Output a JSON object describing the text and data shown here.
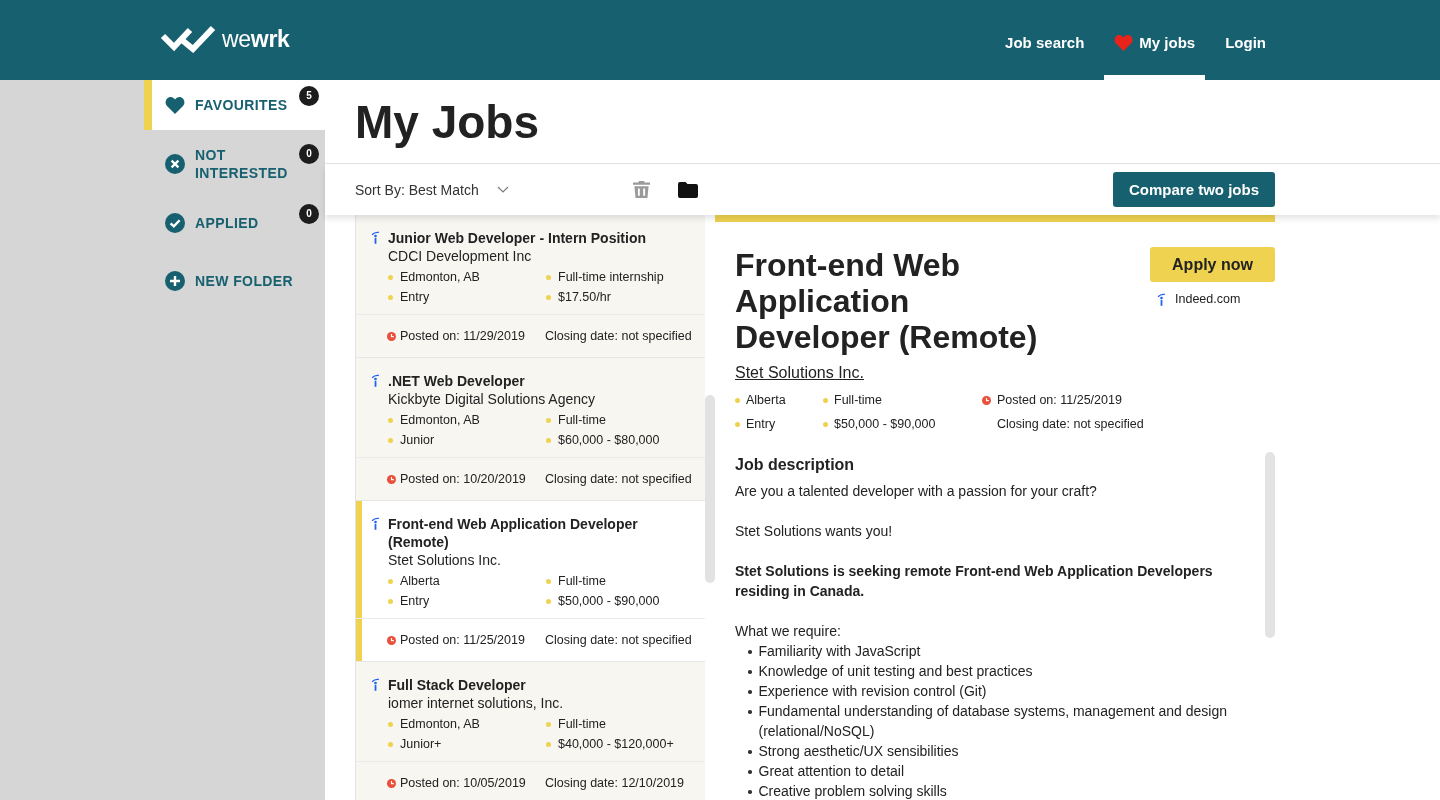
{
  "header": {
    "logo": "we**wrk**",
    "nav": [
      {
        "label": "Job search",
        "kind": "plain",
        "selected": false
      },
      {
        "label": "My jobs",
        "kind": "favourites",
        "selected": true
      },
      {
        "label": "Login",
        "kind": "plain",
        "selected": false
      }
    ]
  },
  "sidebar": {
    "items": [
      {
        "kind": "favourites",
        "label": "FAVOURITES",
        "count": "5",
        "selected": true
      },
      {
        "kind": "not-interested",
        "label": "NOT INTERESTED",
        "count": "0",
        "selected": false
      },
      {
        "kind": "applied",
        "label": "APPLIED",
        "count": "0",
        "selected": false
      },
      {
        "kind": "new-folder",
        "label": "NEW FOLDER",
        "selected": false
      }
    ]
  },
  "page_title": "My Jobs",
  "toolbar": {
    "sort": "Sort By: Best Match",
    "compare_button": "Compare two jobs"
  },
  "jobs": [
    {
      "title": "Junior Web Developer - Intern Position",
      "company": "CDCI Development Inc",
      "location": "Edmonton, AB",
      "type": "Full-time internship",
      "level": "Entry",
      "salary": "$17.50/hr",
      "posted": "Posted on: 11/29/2019",
      "closing": "Closing date: not specified",
      "selected": false
    },
    {
      "title": ".NET Web Developer",
      "company": "Kickbyte Digital Solutions Agency",
      "location": "Edmonton, AB",
      "type": "Full-time",
      "level": "Junior",
      "salary": "$60,000 - $80,000",
      "posted": "Posted on: 10/20/2019",
      "closing": "Closing date: not specified",
      "selected": false
    },
    {
      "title": "Front-end Web Application Developer (Remote)",
      "company": "Stet Solutions Inc.",
      "location": "Alberta",
      "type": "Full-time",
      "level": "Entry",
      "salary": "$50,000 - $90,000",
      "posted": "Posted on: 11/25/2019",
      "closing": "Closing date: not specified",
      "selected": true
    },
    {
      "title": "Full Stack Developer",
      "company": "iomer internet solutions, Inc.",
      "location": "Edmonton, AB",
      "type": "Full-time",
      "level": "Junior+",
      "salary": "$40,000 - $120,000+",
      "posted": "Posted on: 10/05/2019",
      "closing": "Closing date: 12/10/2019",
      "selected": false
    }
  ],
  "detail": {
    "title": "Front-end Web Application Developer (Remote)",
    "apply_button": "Apply now",
    "source": "Indeed.com",
    "company": "Stet Solutions Inc.",
    "location": "Alberta",
    "level": "Entry",
    "type": "Full-time",
    "salary": "$50,000 - $90,000",
    "posted": "Posted on: 11/25/2019",
    "closing": "Closing date: not specified",
    "description": {
      "heading": "Job description",
      "blocks": [
        {
          "kind": "text",
          "text": "Are you a talented developer with a passion for your craft?"
        },
        {
          "kind": "text",
          "text": "Stet Solutions wants you!"
        },
        {
          "kind": "bold",
          "text": "Stet Solutions is seeking remote Front-end Web Application Developers residing in Canada."
        },
        {
          "kind": "list",
          "intro": "What we require:",
          "items": [
            "Familiarity with JavaScript",
            "Knowledge of unit testing and best practices",
            "Experience with revision control (Git)",
            "Fundamental understanding of database systems, management and design (relational/NoSQL)",
            "Strong aesthetic/UX sensibilities",
            "Great attention to detail",
            "Creative problem solving skills"
          ]
        }
      ]
    }
  }
}
